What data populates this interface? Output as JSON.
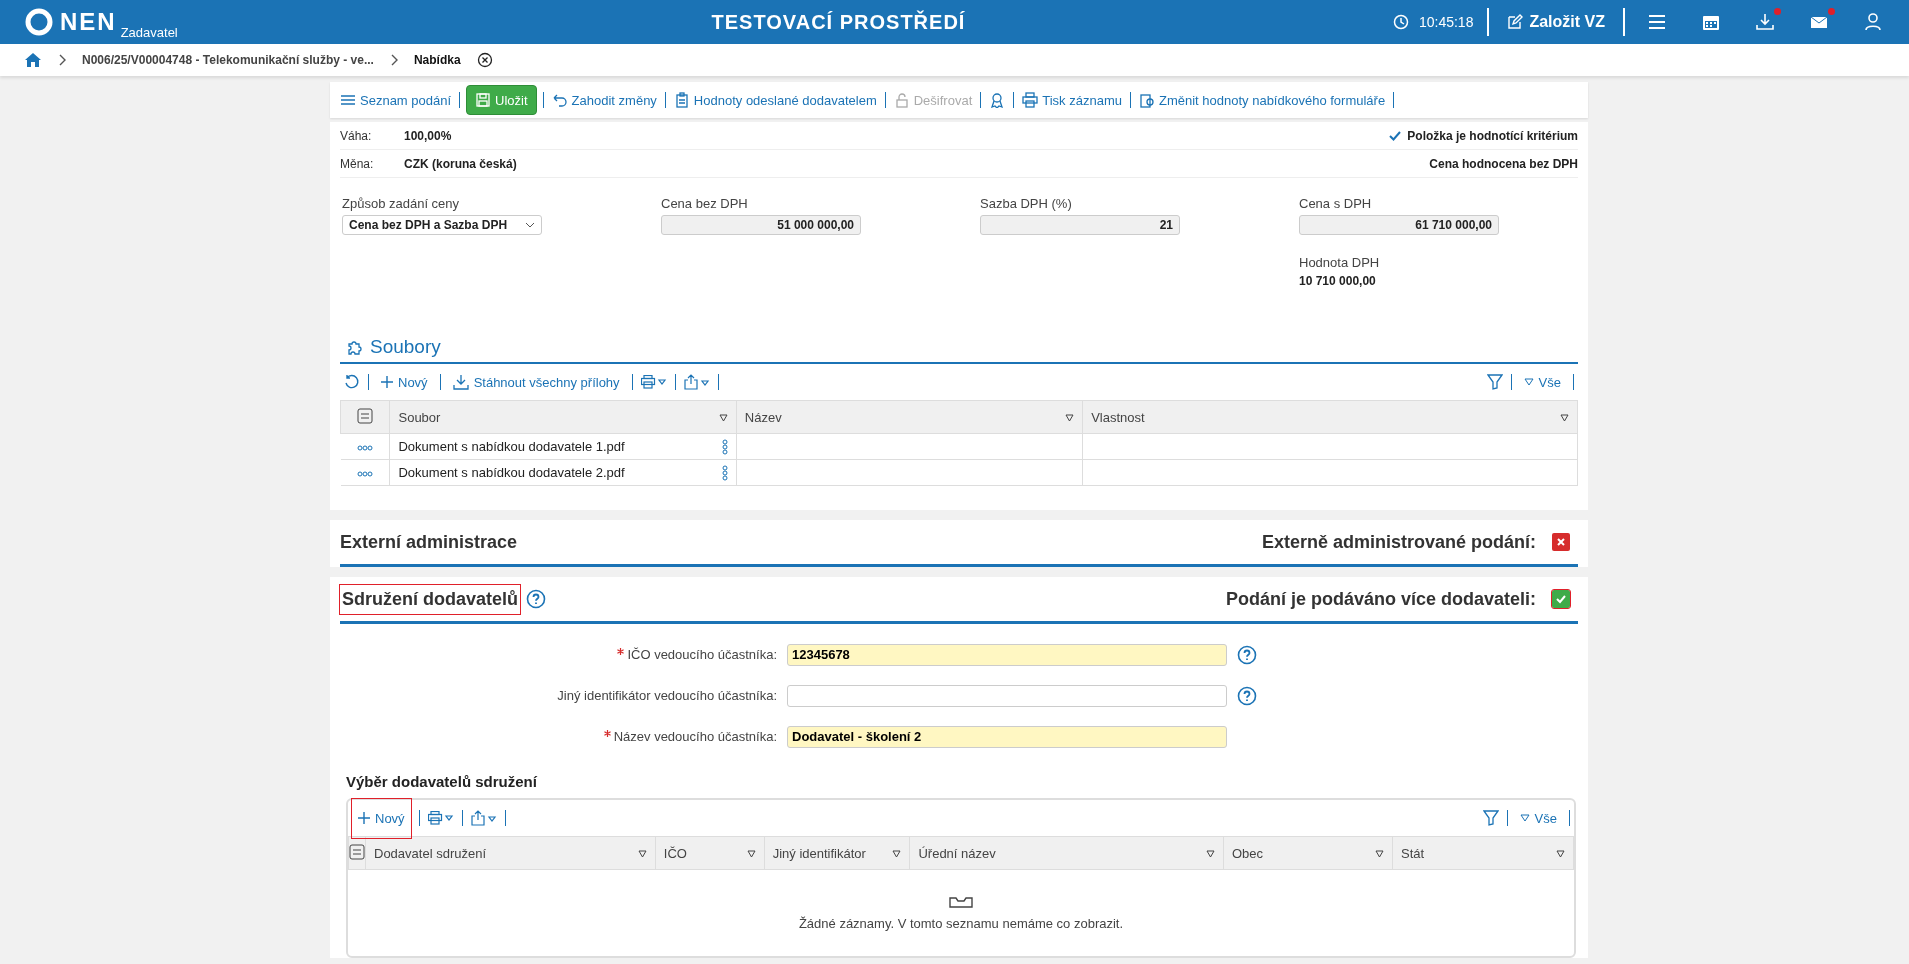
{
  "topbar": {
    "logo": "NEN",
    "role": "Zadavatel",
    "title": "TESTOVACÍ PROSTŘEDÍ",
    "time": "10:45:18",
    "create_button": "Založit VZ",
    "notifications": [
      {
        "kind": "menu",
        "badge": false
      },
      {
        "kind": "calendar",
        "badge": false
      },
      {
        "kind": "download",
        "badge": true
      },
      {
        "kind": "mail",
        "badge": true
      },
      {
        "kind": "user",
        "badge": false
      }
    ]
  },
  "breadcrumb": [
    "N006/25/V00004748 - Telekomunikační služby - ve...",
    "Nabídka"
  ],
  "toolbar": [
    {
      "kind": "list",
      "label": "Seznam podání",
      "disabled": false
    },
    {
      "kind": "save",
      "label": "Uložit",
      "disabled": false
    },
    {
      "kind": "undo",
      "label": "Zahodit změny",
      "disabled": false
    },
    {
      "kind": "clipboard",
      "label": "Hodnoty odeslané dodavatelem",
      "disabled": false
    },
    {
      "kind": "lock",
      "label": "Dešifrovat",
      "disabled": true
    },
    {
      "kind": "award",
      "disabled": false
    },
    {
      "kind": "print",
      "label": "Tisk záznamu",
      "disabled": false
    },
    {
      "kind": "settings",
      "label": "Změnit hodnoty nabídkového formuláře",
      "disabled": false
    }
  ],
  "summary": {
    "rows": [
      {
        "label": "Váha:",
        "value": "100,00%",
        "right": "Položka je hodnotící kritérium",
        "right_checked": true
      },
      {
        "label": "Měna:",
        "value": "CZK (koruna česká)",
        "right": "Cena hodnocena bez DPH",
        "right_checked": false
      }
    ]
  },
  "price": {
    "mode_label": "Způsob zadání ceny",
    "mode_value": "Cena bez DPH a Sazba DPH",
    "fields": [
      {
        "label": "Cena bez DPH",
        "value": "51 000 000,00"
      },
      {
        "label": "Sazba DPH (%)",
        "value": "21"
      },
      {
        "label": "Cena s DPH",
        "value": "61 710 000,00"
      }
    ],
    "vat_label": "Hodnota DPH",
    "vat_value": "10 710 000,00"
  },
  "files": {
    "title": "Soubory",
    "new": "Nový",
    "download_all": "Stáhnout všechny přílohy",
    "filter_all": "Vše",
    "columns": [
      "Soubor",
      "Název",
      "Vlastnost"
    ],
    "rows": [
      [
        "Dokument s nabídkou dodavatele 1.pdf",
        "",
        ""
      ],
      [
        "Dokument s nabídkou dodavatele 2.pdf",
        "",
        ""
      ]
    ]
  },
  "external": {
    "title": "Externí administrace",
    "flag_label": "Externě administrované podání:",
    "positive": false
  },
  "association": {
    "title": "Sdružení dodavatelů",
    "highlighted": true,
    "flag_label": "Podání je podáváno více dodavateli:",
    "positive": true,
    "fields": [
      {
        "label": "IČO vedoucího účastníka:",
        "value": "12345678",
        "required": true,
        "help": true
      },
      {
        "label": "Jiný identifikátor vedoucího účastníka:",
        "required": false,
        "help": true
      },
      {
        "label": "Název vedoucího účastníka:",
        "value": "Dodavatel - školení 2",
        "required": true,
        "help": false
      }
    ],
    "list_title": "Výběr dodavatelů sdružení",
    "new": "Nový",
    "new_highlighted": true,
    "filter_all": "Vše",
    "columns": [
      "Dodavatel sdružení",
      "IČO",
      "Jiný identifikátor",
      "Úřední název",
      "Obec",
      "Stát"
    ],
    "empty": "Žádné záznamy. V tomto seznamu nemáme co zobrazit."
  }
}
